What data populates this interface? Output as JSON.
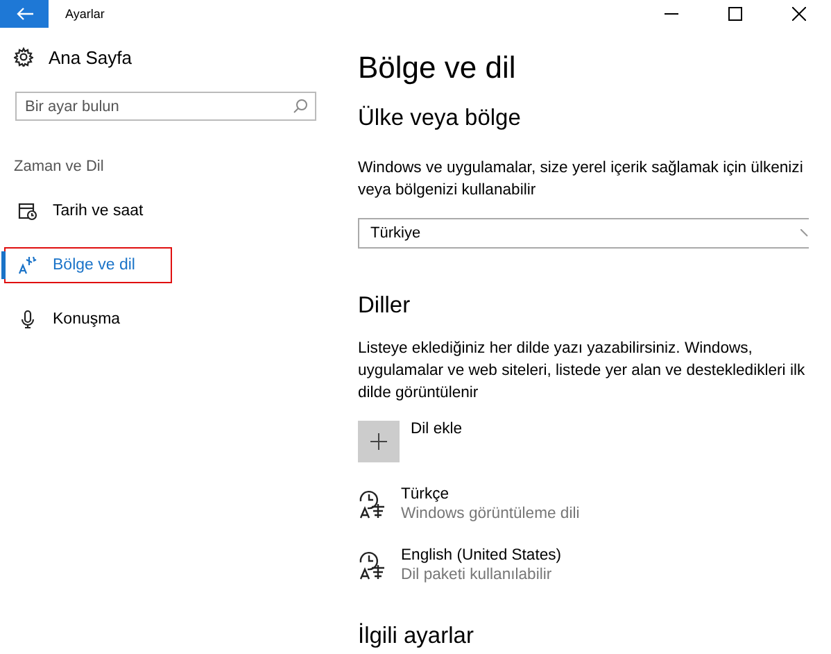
{
  "window": {
    "title": "Ayarlar"
  },
  "sidebar": {
    "home": "Ana Sayfa",
    "search": {
      "placeholder": "Bir ayar bulun"
    },
    "section": "Zaman ve Dil",
    "items": [
      {
        "label": "Tarih ve saat",
        "selected": false
      },
      {
        "label": "Bölge ve dil",
        "selected": true
      },
      {
        "label": "Konuşma",
        "selected": false
      }
    ]
  },
  "main": {
    "title": "Bölge ve dil",
    "region": {
      "heading": "Ülke veya bölge",
      "description": "Windows ve uygulamalar, size yerel içerik sağlamak için ülkenizi veya bölgenizi kullanabilir",
      "value": "Türkiye"
    },
    "languages": {
      "heading": "Diller",
      "description": "Listeye eklediğiniz her dilde yazı yazabilirsiniz. Windows, uygulamalar ve web siteleri, listede yer alan ve destekledikleri ilk dilde görüntülenir",
      "add_label": "Dil ekle",
      "items": [
        {
          "name": "Türkçe",
          "status": "Windows görüntüleme dili"
        },
        {
          "name": "English (United States)",
          "status": "Dil paketi kullanılabilir"
        }
      ]
    },
    "related_heading": "İlgili ayarlar"
  }
}
